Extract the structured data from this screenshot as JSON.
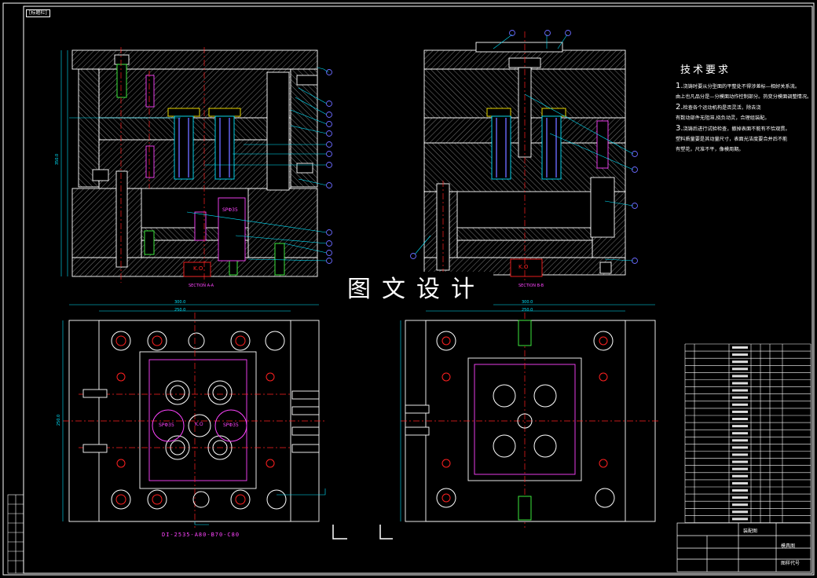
{
  "sheet_tag": "[标题栏]",
  "watermark": "图文设计",
  "tech_requirements": {
    "title": "技术要求",
    "items": [
      {
        "num": "1.",
        "text": "浇铸时要从分型面的平整处不得涉差标—相好关系流。"
      },
      {
        "num": "",
        "text": "由上也凡品分是—分模面动作控制部分。热变分模面调整情况。"
      },
      {
        "num": "2.",
        "text": "检查各个运动机构是否灵活，除去浇"
      },
      {
        "num": "",
        "text": "有数动部件无阻滞,挠负动灵，合理组装配。"
      },
      {
        "num": "3.",
        "text": "浇铸后进行试验检查，撤掉表面不能有不恰观贯。"
      },
      {
        "num": "",
        "text": "塑料质量要是其动量尺寸，表面光洁度要合并后不能"
      },
      {
        "num": "",
        "text": "有塑花，尺准不平，像模周期。"
      }
    ]
  },
  "section_labels": {
    "left": "SECTION A-A",
    "right": "SECTION B-B"
  },
  "part_labels": {
    "spec1": "SPΦ35",
    "spec2": "SPΦ35",
    "spec3": "SPΦ35",
    "k1": "K.O",
    "k2": "K.O",
    "k3": "K.O"
  },
  "mold_code": "DI-2535-A80-B70-C80",
  "dims": {
    "left_top_outer": "300.0",
    "left_top_inner": "250.0",
    "right_top_outer": "300.0",
    "right_top_inner": "250.0",
    "left_side": "250.0",
    "left_height": "350.0"
  },
  "title_block": {
    "drawing_name": "装配图",
    "drawing_label": "模具图",
    "drawing_code": "图样代号"
  },
  "colors": {
    "line": "#ffffff",
    "hatch": "#bbbbbb",
    "cyan": "#00e5ff",
    "red": "#ff2020",
    "magenta": "#ff44ff",
    "yellow": "#ffee00",
    "green": "#44ff44",
    "blue": "#6a6aff"
  }
}
